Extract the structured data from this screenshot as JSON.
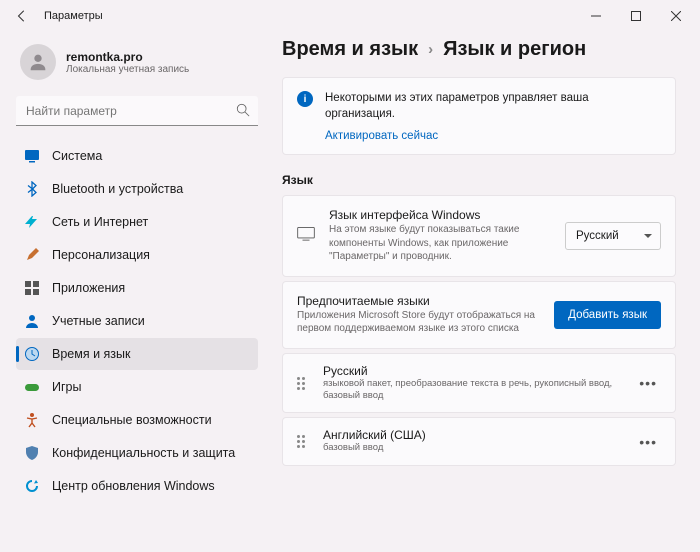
{
  "window": {
    "title": "Параметры"
  },
  "user": {
    "name": "remontka.pro",
    "account": "Локальная учетная запись"
  },
  "search": {
    "placeholder": "Найти параметр"
  },
  "nav": [
    {
      "label": "Система",
      "icon": "system"
    },
    {
      "label": "Bluetooth и устройства",
      "icon": "bluetooth"
    },
    {
      "label": "Сеть и Интернет",
      "icon": "wifi"
    },
    {
      "label": "Персонализация",
      "icon": "brush"
    },
    {
      "label": "Приложения",
      "icon": "apps"
    },
    {
      "label": "Учетные записи",
      "icon": "account"
    },
    {
      "label": "Время и язык",
      "icon": "clock"
    },
    {
      "label": "Игры",
      "icon": "game"
    },
    {
      "label": "Специальные возможности",
      "icon": "accessibility"
    },
    {
      "label": "Конфиденциальность и защита",
      "icon": "shield"
    },
    {
      "label": "Центр обновления Windows",
      "icon": "update"
    }
  ],
  "crumb": {
    "a": "Время и язык",
    "b": "Язык и регион"
  },
  "info": {
    "text": "Некоторыми из этих параметров управляет ваша организация.",
    "link": "Активировать сейчас"
  },
  "section": {
    "lang": "Язык"
  },
  "winlang": {
    "title": "Язык интерфейса Windows",
    "desc": "На этом языке будут показываться такие компоненты Windows, как приложение \"Параметры\" и проводник.",
    "value": "Русский"
  },
  "pref": {
    "title": "Предпочитаемые языки",
    "desc": "Приложения Microsoft Store будут отображаться на первом поддерживаемом языке из этого списка",
    "button": "Добавить язык"
  },
  "langs": [
    {
      "name": "Русский",
      "feat": "языковой пакет, преобразование текста в речь, рукописный ввод, базовый ввод"
    },
    {
      "name": "Английский (США)",
      "feat": "базовый ввод"
    }
  ]
}
